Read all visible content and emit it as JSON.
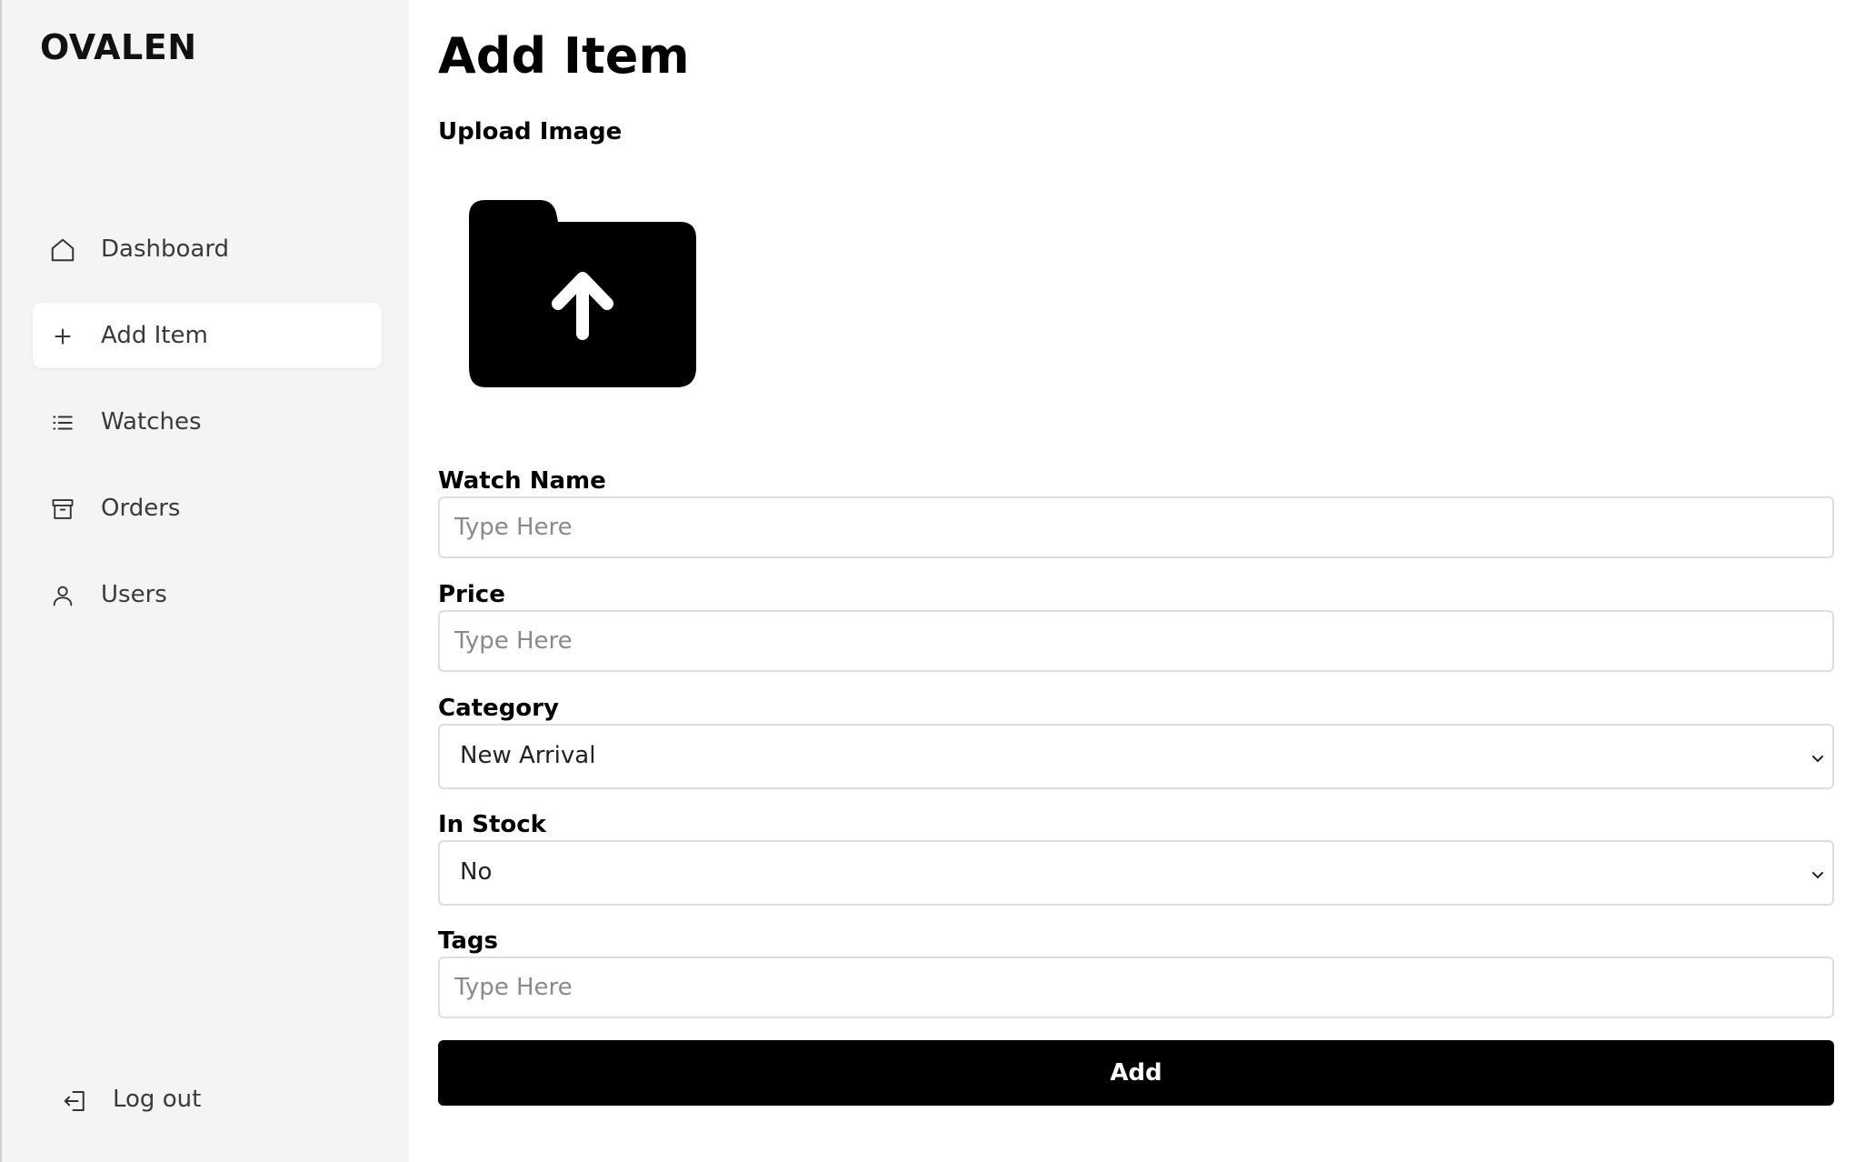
{
  "brand": "OVALEN",
  "sidebar": {
    "items": [
      {
        "label": "Dashboard",
        "icon": "home-icon"
      },
      {
        "label": "Add Item",
        "icon": "plus-icon",
        "active": true
      },
      {
        "label": "Watches",
        "icon": "list-icon"
      },
      {
        "label": "Orders",
        "icon": "archive-icon"
      },
      {
        "label": "Users",
        "icon": "user-icon"
      }
    ],
    "logout": {
      "label": "Log out",
      "icon": "logout-icon"
    }
  },
  "main": {
    "title": "Add Item",
    "upload": {
      "label": "Upload Image",
      "icon": "folder-upload-icon"
    },
    "watch_name": {
      "label": "Watch Name",
      "placeholder": "Type Here",
      "value": ""
    },
    "price": {
      "label": "Price",
      "placeholder": "Type Here",
      "value": ""
    },
    "category": {
      "label": "Category",
      "value": "New Arrival"
    },
    "in_stock": {
      "label": "In Stock",
      "value": "No"
    },
    "tags": {
      "label": "Tags",
      "placeholder": "Type Here",
      "value": ""
    },
    "add_button": "Add"
  },
  "colors": {
    "sidebar_bg": "#f4f4f4",
    "active_item_bg": "#ffffff",
    "button_bg": "#000000",
    "button_text": "#ffffff"
  }
}
